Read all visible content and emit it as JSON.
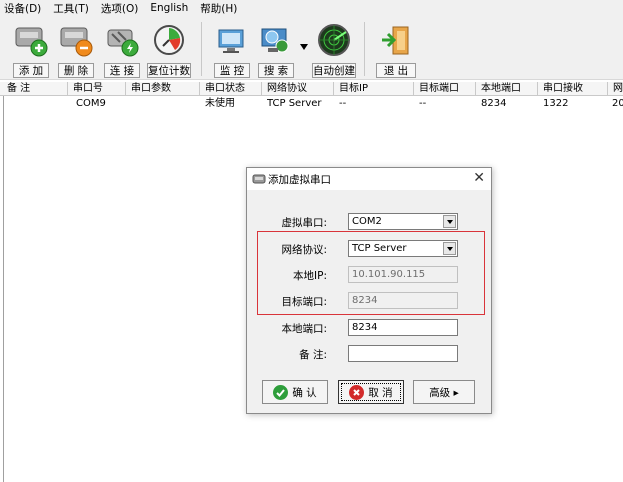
{
  "menu": [
    "设备(D)",
    "工具(T)",
    "选项(O)",
    "English",
    "帮助(H)"
  ],
  "toolbar": {
    "add": "添 加",
    "delete": "删 除",
    "connect": "连 接",
    "reset": "复位计数",
    "monitor": "监 控",
    "search": "搜 索",
    "auto_create": "自动创建",
    "exit": "退 出"
  },
  "columns": [
    "备 注",
    "串口号",
    "串口参数",
    "串口状态",
    "网络协议",
    "目标IP",
    "目标端口",
    "本地端口",
    "串口接收",
    "网"
  ],
  "rows": [
    [
      "",
      "COM9",
      "",
      "未使用",
      "TCP Server",
      "--",
      "--",
      "8234",
      "1322",
      "20"
    ]
  ],
  "dialog": {
    "title": "添加虚拟串口",
    "close": "✕",
    "virtual_port_label": "虚拟串口:",
    "virtual_port_value": "COM2",
    "protocol_label": "网络协议:",
    "protocol_value": "TCP Server",
    "local_ip_label": "本地IP:",
    "local_ip_value": "10.101.90.115",
    "target_port_label": "目标端口:",
    "target_port_value": "8234",
    "local_port_label": "本地端口:",
    "local_port_value": "8234",
    "note_label": "备 注:",
    "note_value": "",
    "ok_label": "确 认",
    "cancel_label": "取 消",
    "advanced_label": "高级 ▸"
  },
  "colors": {
    "highlight_box": "#d9343a",
    "ok_icon": "#2e9e3b",
    "cancel_icon": "#d22b2b"
  }
}
